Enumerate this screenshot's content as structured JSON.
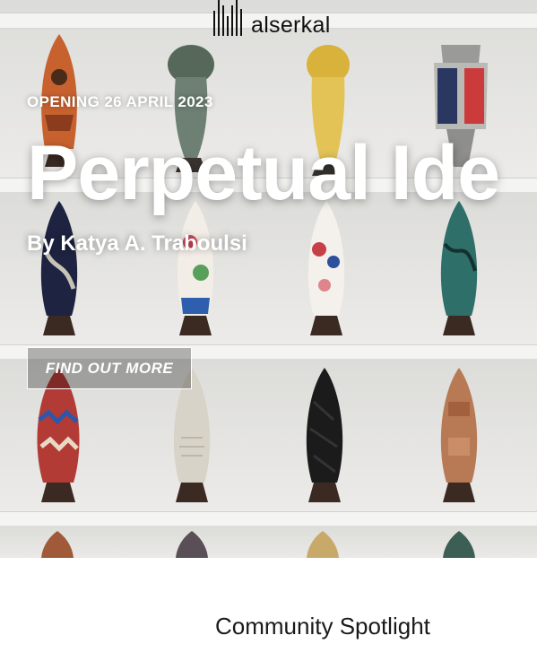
{
  "header": {
    "logo_text": "alserkal"
  },
  "hero": {
    "eyebrow": "OPENING 26 APRIL 2023",
    "title": "Perpetual Ide",
    "byline": "By Katya A. Traboulsi",
    "cta_label": "FIND OUT MORE"
  },
  "sections": {
    "spotlight_title": "Community Spotlight"
  },
  "colors": {
    "accent_text": "#ffffff",
    "page_bg": "#ffffff",
    "heading": "#1a1a1a"
  },
  "icons": [
    "alserkal-logo-icon"
  ]
}
